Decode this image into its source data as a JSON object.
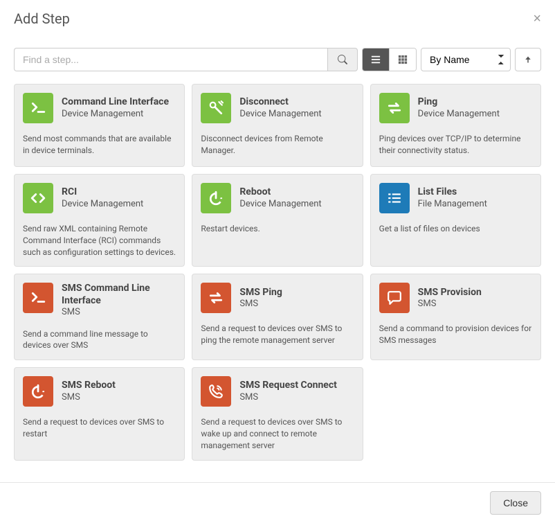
{
  "modal": {
    "title": "Add Step"
  },
  "search": {
    "placeholder": "Find a step..."
  },
  "sort": {
    "selected": "By Name"
  },
  "cards": [
    {
      "title": "Command Line Interface",
      "category": "Device Management",
      "desc": "Send most commands that are available in device terminals.",
      "icon": "terminal",
      "color": "green"
    },
    {
      "title": "Disconnect",
      "category": "Device Management",
      "desc": "Disconnect devices from Remote Manager.",
      "icon": "unplug",
      "color": "green"
    },
    {
      "title": "Ping",
      "category": "Device Management",
      "desc": "Ping devices over TCP/IP to determine their connectivity status.",
      "icon": "arrows",
      "color": "green"
    },
    {
      "title": "RCI",
      "category": "Device Management",
      "desc": "Send raw XML containing Remote Command Interface (RCI) commands such as configuration settings to devices.",
      "icon": "code",
      "color": "green"
    },
    {
      "title": "Reboot",
      "category": "Device Management",
      "desc": "Restart devices.",
      "icon": "power",
      "color": "green"
    },
    {
      "title": "List Files",
      "category": "File Management",
      "desc": "Get a list of files on devices",
      "icon": "list",
      "color": "blue"
    },
    {
      "title": "SMS Command Line Interface",
      "category": "SMS",
      "desc": "Send a command line message to devices over SMS",
      "icon": "terminal",
      "color": "orange"
    },
    {
      "title": "SMS Ping",
      "category": "SMS",
      "desc": "Send a request to devices over SMS to ping the remote management server",
      "icon": "arrows",
      "color": "orange"
    },
    {
      "title": "SMS Provision",
      "category": "SMS",
      "desc": "Send a command to provision devices for SMS messages",
      "icon": "chat",
      "color": "orange"
    },
    {
      "title": "SMS Reboot",
      "category": "SMS",
      "desc": "Send a request to devices over SMS to restart",
      "icon": "power",
      "color": "orange"
    },
    {
      "title": "SMS Request Connect",
      "category": "SMS",
      "desc": "Send a request to devices over SMS to wake up and connect to remote management server",
      "icon": "phone",
      "color": "orange"
    }
  ],
  "footer": {
    "close": "Close"
  }
}
